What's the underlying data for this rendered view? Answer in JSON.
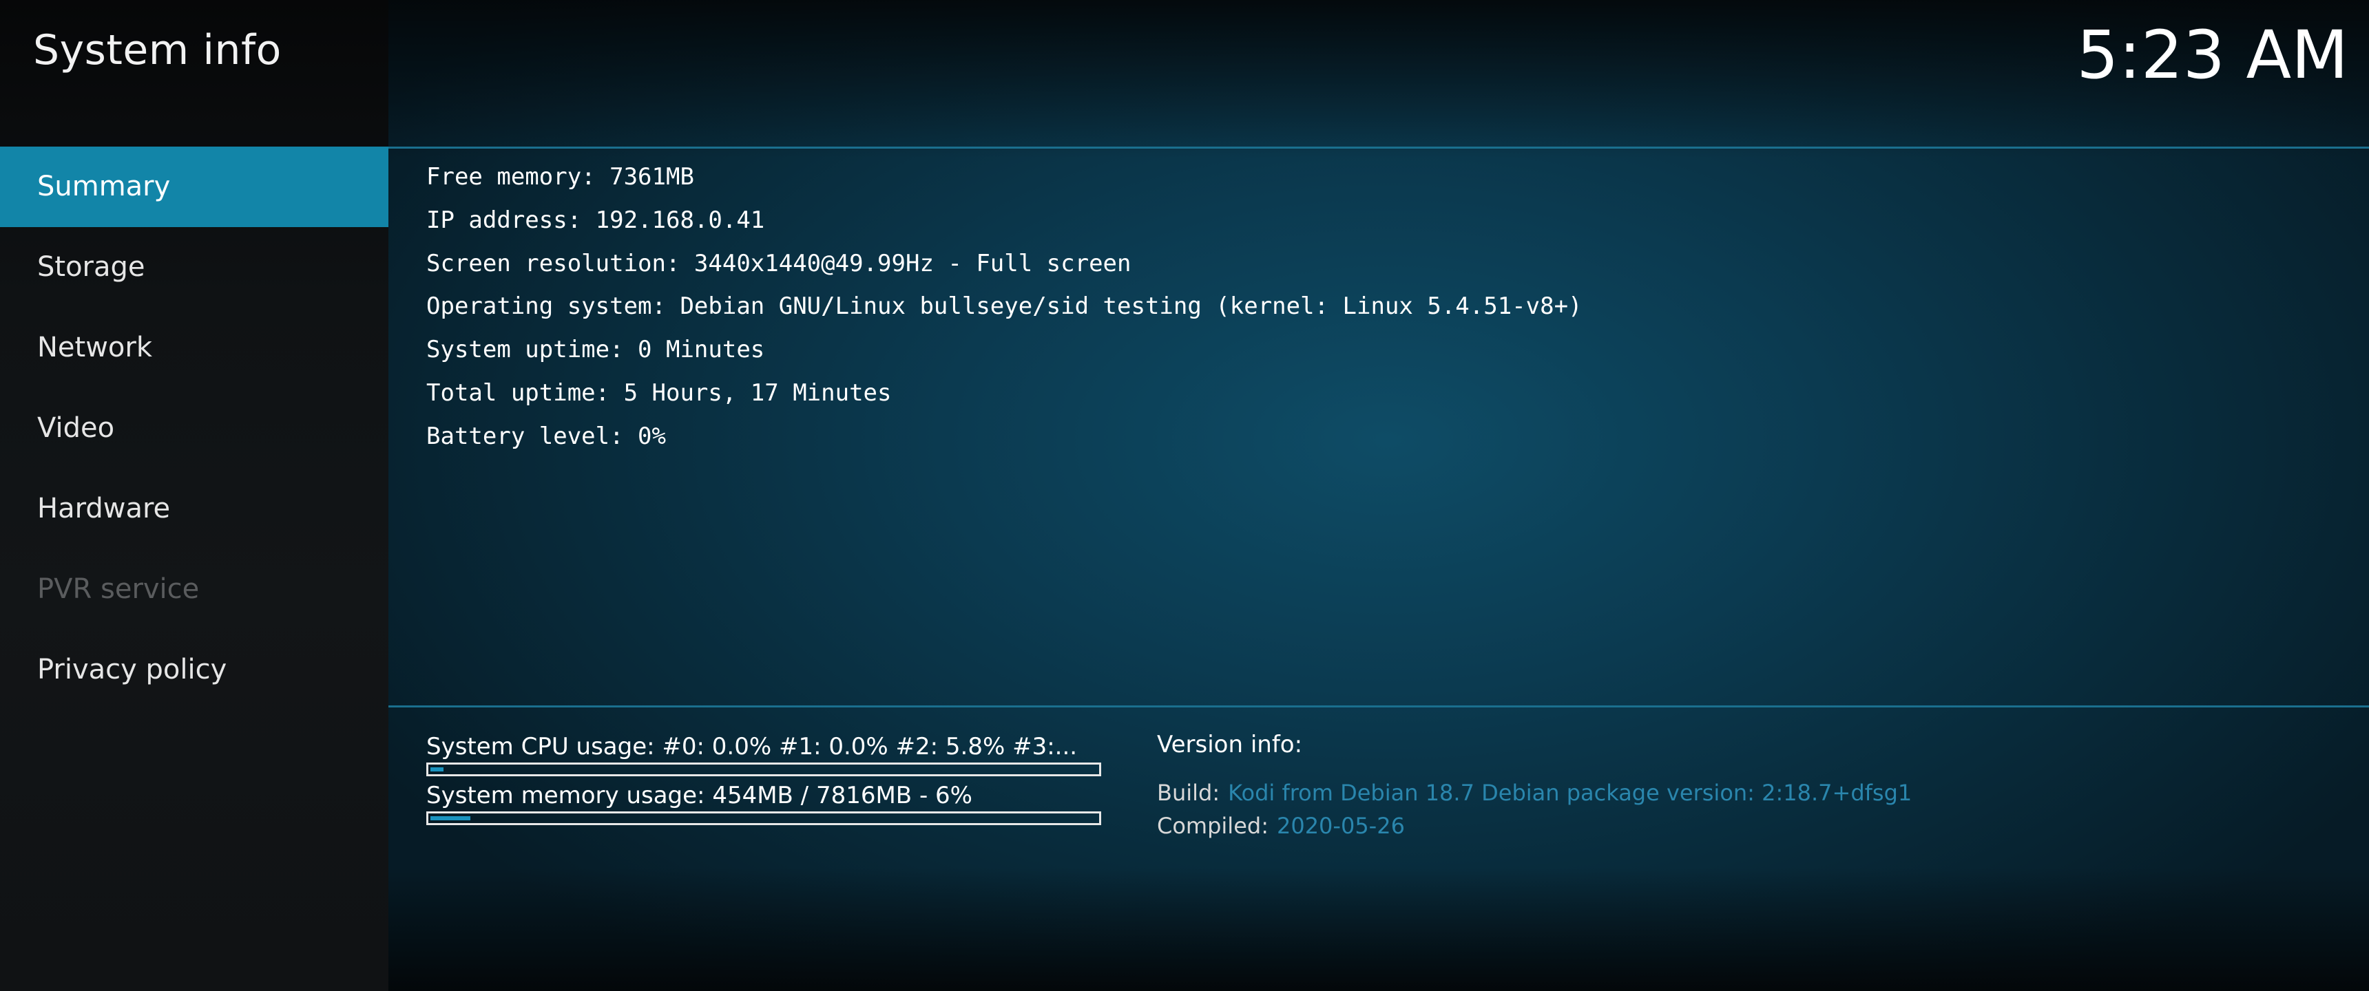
{
  "header": {
    "title": "System info",
    "clock": "5:23 AM"
  },
  "sidebar": {
    "items": [
      {
        "label": "Summary",
        "state": "selected"
      },
      {
        "label": "Storage",
        "state": "normal"
      },
      {
        "label": "Network",
        "state": "normal"
      },
      {
        "label": "Video",
        "state": "normal"
      },
      {
        "label": "Hardware",
        "state": "normal"
      },
      {
        "label": "PVR service",
        "state": "disabled"
      },
      {
        "label": "Privacy policy",
        "state": "normal"
      }
    ]
  },
  "summary": {
    "lines": [
      "Free memory: 7361MB",
      "IP address: 192.168.0.41",
      "Screen resolution: 3440x1440@49.99Hz - Full screen",
      "Operating system: Debian GNU/Linux bullseye/sid testing (kernel: Linux 5.4.51-v8+)",
      "System uptime: 0 Minutes",
      "Total uptime: 5 Hours, 17 Minutes",
      "Battery level: 0%"
    ]
  },
  "usage": {
    "cpu_label": "System CPU usage: #0: 0.0% #1: 0.0% #2: 5.8% #3:...",
    "cpu_percent": 2,
    "memory_label": "System memory usage: 454MB / 7816MB - 6%",
    "memory_percent": 6
  },
  "version": {
    "title": "Version info:",
    "build_key": "Build:",
    "build_value": "Kodi from Debian 18.7 Debian package version: 2:18.7+dfsg1",
    "compiled_key": "Compiled:",
    "compiled_value": "2020-05-26"
  },
  "colors": {
    "accent": "#1285a8",
    "value_text": "#2a86ad"
  }
}
